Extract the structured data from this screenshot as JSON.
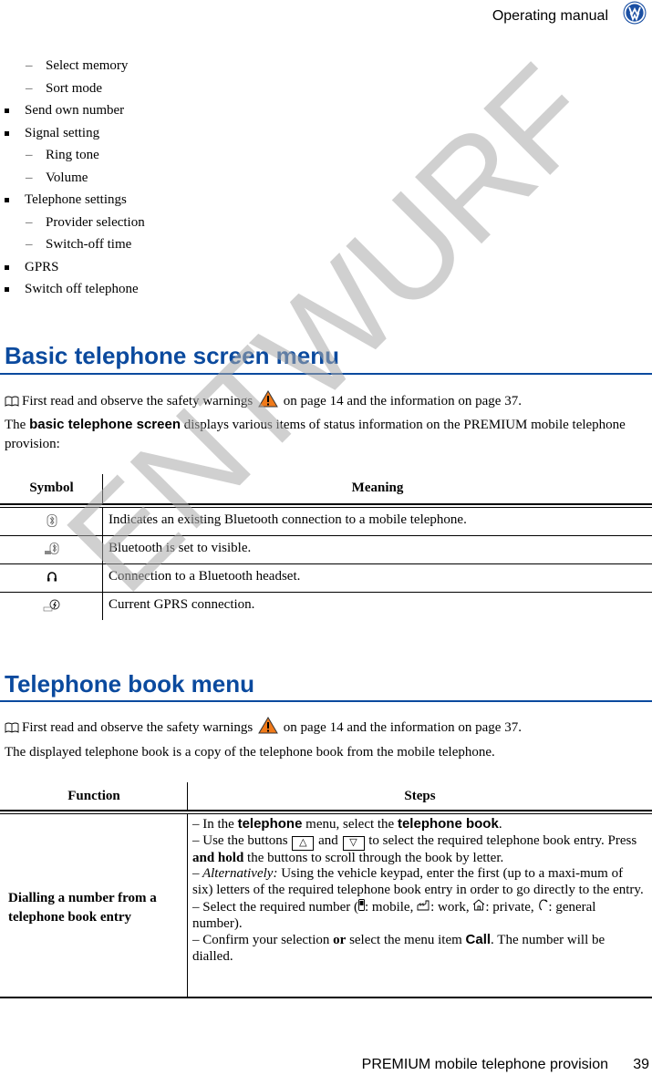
{
  "header": {
    "title": "Operating manual",
    "logo": "vw-logo"
  },
  "menu_list": [
    {
      "level": 2,
      "label": "Select memory"
    },
    {
      "level": 2,
      "label": "Sort mode"
    },
    {
      "level": 1,
      "label": "Send own number"
    },
    {
      "level": 1,
      "label": "Signal setting"
    },
    {
      "level": 2,
      "label": "Ring tone"
    },
    {
      "level": 2,
      "label": "Volume"
    },
    {
      "level": 1,
      "label": "Telephone settings"
    },
    {
      "level": 2,
      "label": "Provider selection"
    },
    {
      "level": 2,
      "label": "Switch-off time"
    },
    {
      "level": 1,
      "label": "GPRS"
    },
    {
      "level": 1,
      "label": "Switch off telephone"
    }
  ],
  "section1": {
    "title": "Basic telephone screen menu",
    "note_before": "First read and observe the safety warnings",
    "note_after": "on page 14 and the information on page 37.",
    "intro_pre": "The",
    "intro_bold": "basic telephone screen",
    "intro_post": "displays various items of status information on the PREMIUM mobile telephone provision:",
    "table": {
      "headers": [
        "Symbol",
        "Meaning"
      ],
      "rows": [
        {
          "icon": "bluetooth-icon",
          "meaning": "Indicates an existing Bluetooth connection to a mobile telephone."
        },
        {
          "icon": "bluetooth-visible-icon",
          "meaning": "Bluetooth is set to visible."
        },
        {
          "icon": "headset-icon",
          "meaning": "Connection to a Bluetooth headset."
        },
        {
          "icon": "gprs-icon",
          "meaning": "Current GPRS connection."
        }
      ]
    }
  },
  "section2": {
    "title": "Telephone book menu",
    "note_before": "First read and observe the safety warnings",
    "note_after": "on page 14 and the information on page 37.",
    "intro": "The displayed telephone book is a copy of the telephone book from the mobile telephone.",
    "table": {
      "headers": [
        "Function",
        "Steps"
      ],
      "function": "Dialling a number from a telephone book entry",
      "steps": {
        "s1_a": "– In the",
        "s1_b": "telephone",
        "s1_c": "menu, select the",
        "s1_d": "telephone book",
        "s1_e": ".",
        "s2_a": "– Use the buttons",
        "s2_up": "△",
        "s2_and": "and",
        "s2_down": "▽",
        "s2_b": "to select the required telephone book entry. Press",
        "s2_bold": "and hold",
        "s2_c": "the buttons to scroll through the book by letter.",
        "s3_it": "– Alternatively:",
        "s3_b": "Using the vehicle keypad, enter the first (up to a maxi-mum of six) letters of the required telephone book entry in order to go directly to the entry.",
        "s4_a": "– Select the required number (",
        "s4_mobile": ": mobile,",
        "s4_work": ": work,",
        "s4_private": ": private,",
        "s4_general": ": general number).",
        "s5_a": "– Confirm your selection",
        "s5_or": "or",
        "s5_b": "select the menu item",
        "s5_call": "Call",
        "s5_c": ". The number will be dialled."
      }
    }
  },
  "watermark": "ENTWURF",
  "footer": {
    "title": "PREMIUM mobile telephone provision",
    "page": "39"
  },
  "colors": {
    "heading": "#0b4a9e",
    "warning": "#f07a1a",
    "watermark": "#aaaaaa"
  }
}
